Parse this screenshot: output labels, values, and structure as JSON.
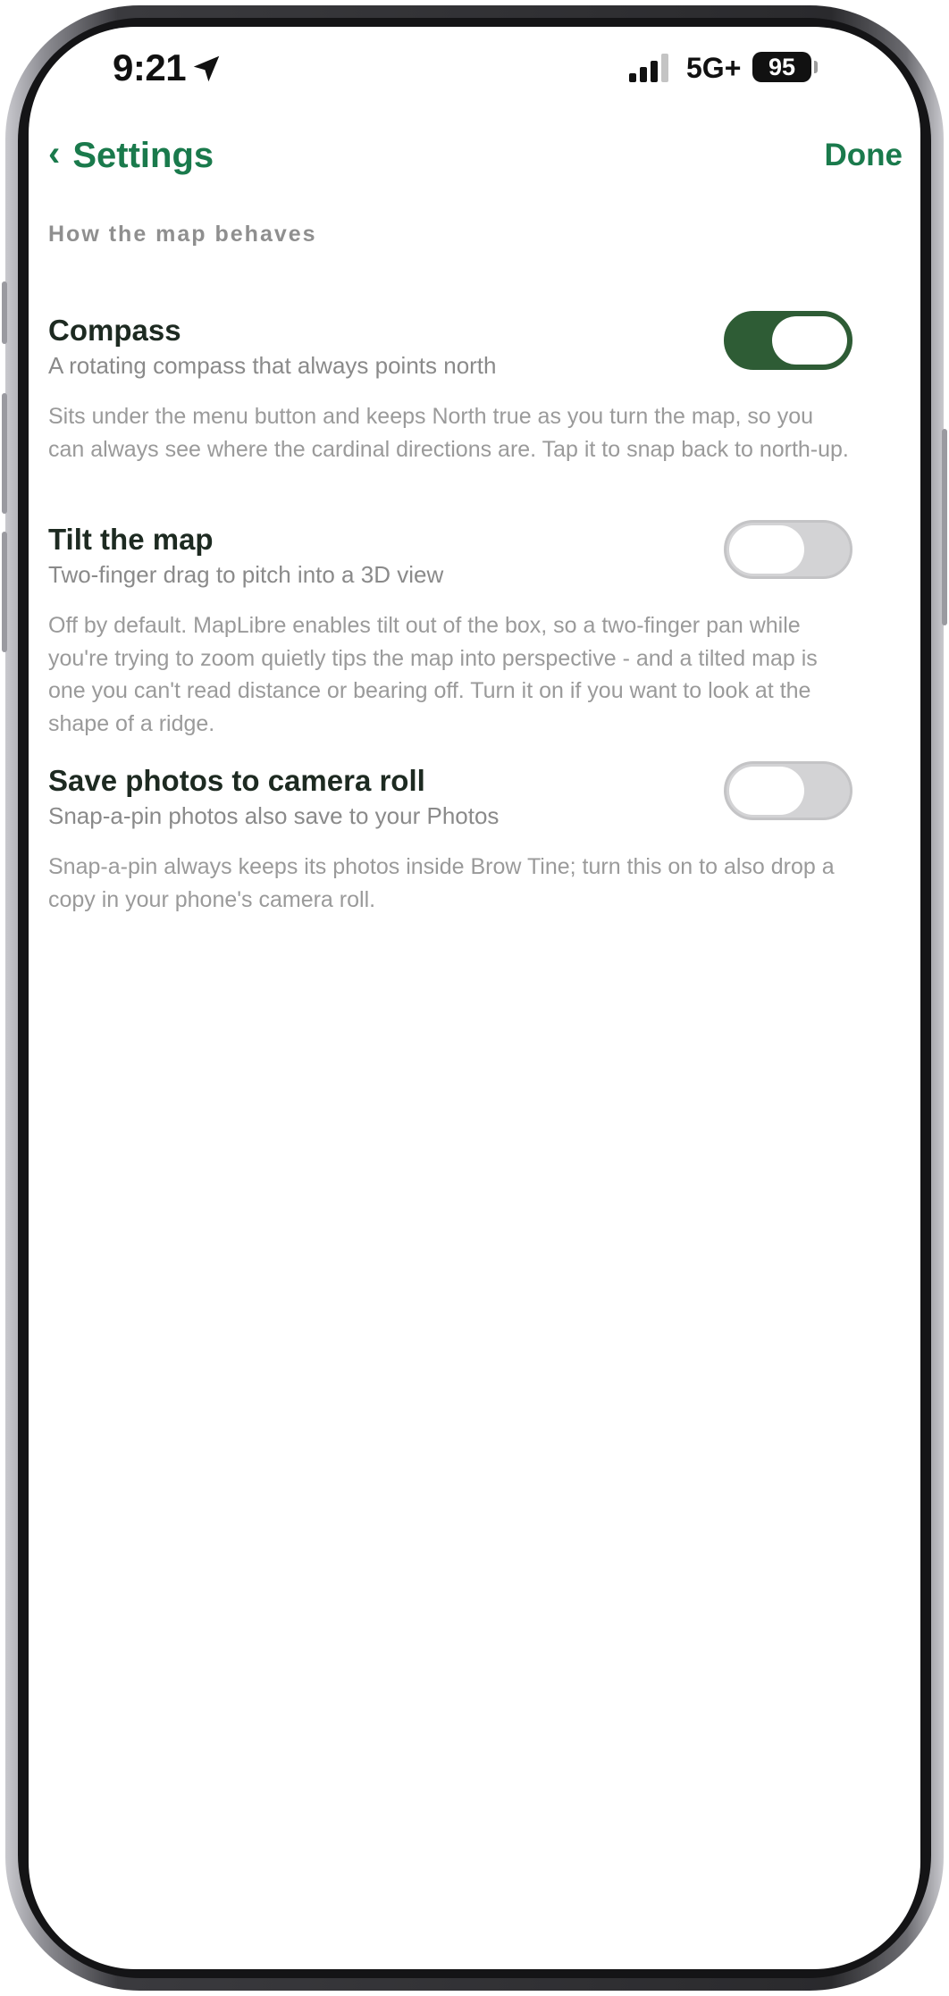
{
  "status_bar": {
    "time": "9:21",
    "network": "5G+",
    "battery": "95",
    "location_icon": "location-arrow-icon",
    "signal_icon": "cellular-signal-icon"
  },
  "nav": {
    "back_label": "Settings",
    "back_icon": "chevron-left-icon",
    "done_label": "Done"
  },
  "section": {
    "header": "How the map behaves"
  },
  "settings": [
    {
      "title": "Compass",
      "subtitle": "A rotating compass that always points north",
      "description": "Sits under the menu button and keeps North true as you turn the map, so you can always see where the cardinal directions are. Tap it to snap back to north-up.",
      "enabled": true
    },
    {
      "title": "Tilt the map",
      "subtitle": "Two-finger drag to pitch into a 3D view",
      "description": "Off by default. MapLibre enables tilt out of the box, so a two-finger pan while you're trying to zoom quietly tips the map into perspective - and a tilted map is one you can't read distance or bearing off. Turn it on if you want to look at the shape of a ridge.",
      "enabled": false
    },
    {
      "title": "Save photos to camera roll",
      "subtitle": "Snap-a-pin photos also save to your Photos",
      "description": "Snap-a-pin always keeps its photos inside Brow Tine; turn this on to also drop a copy in your phone's camera roll.",
      "enabled": false
    }
  ],
  "colors": {
    "accent": "#1a7a4c",
    "toggle_on": "#2e5c35",
    "toggle_off": "#d3d3d5"
  }
}
